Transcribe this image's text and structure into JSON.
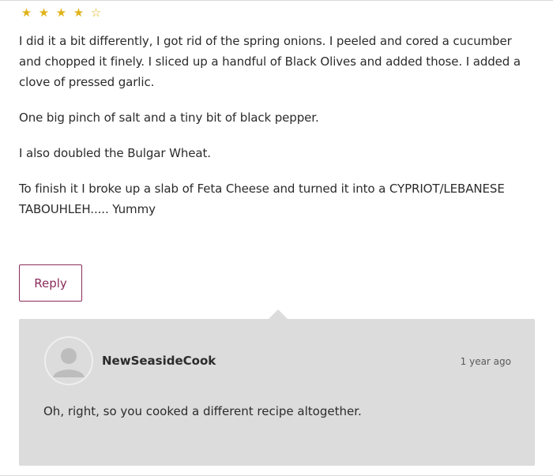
{
  "comment": {
    "rating": {
      "filled": 4,
      "total": 5,
      "star_color": "#e0b31a",
      "filled_glyph": "★",
      "empty_glyph": "☆"
    },
    "paragraphs": [
      "I did it a bit differently, I got rid of the spring onions. I peeled and cored a cucumber and chopped it finely. I sliced up a handful of Black Olives and added those. I added a clove of pressed garlic.",
      "One big pinch of salt and a tiny bit of black pepper.",
      "I also doubled the Bulgar Wheat.",
      "To finish it I broke up a slab of Feta Cheese and turned it into a CYPRIOT/LEBANESE TABOUHLEH..... Yummy"
    ],
    "reply_button_label": "Reply",
    "accent_color": "#8a2c5a"
  },
  "reply": {
    "author": "NewSeasideCook",
    "timestamp": "1 year ago",
    "text": "Oh, right, so you cooked a different recipe altogether.",
    "avatar_icon": "default-avatar-icon",
    "card_color": "#dcdcdc"
  }
}
